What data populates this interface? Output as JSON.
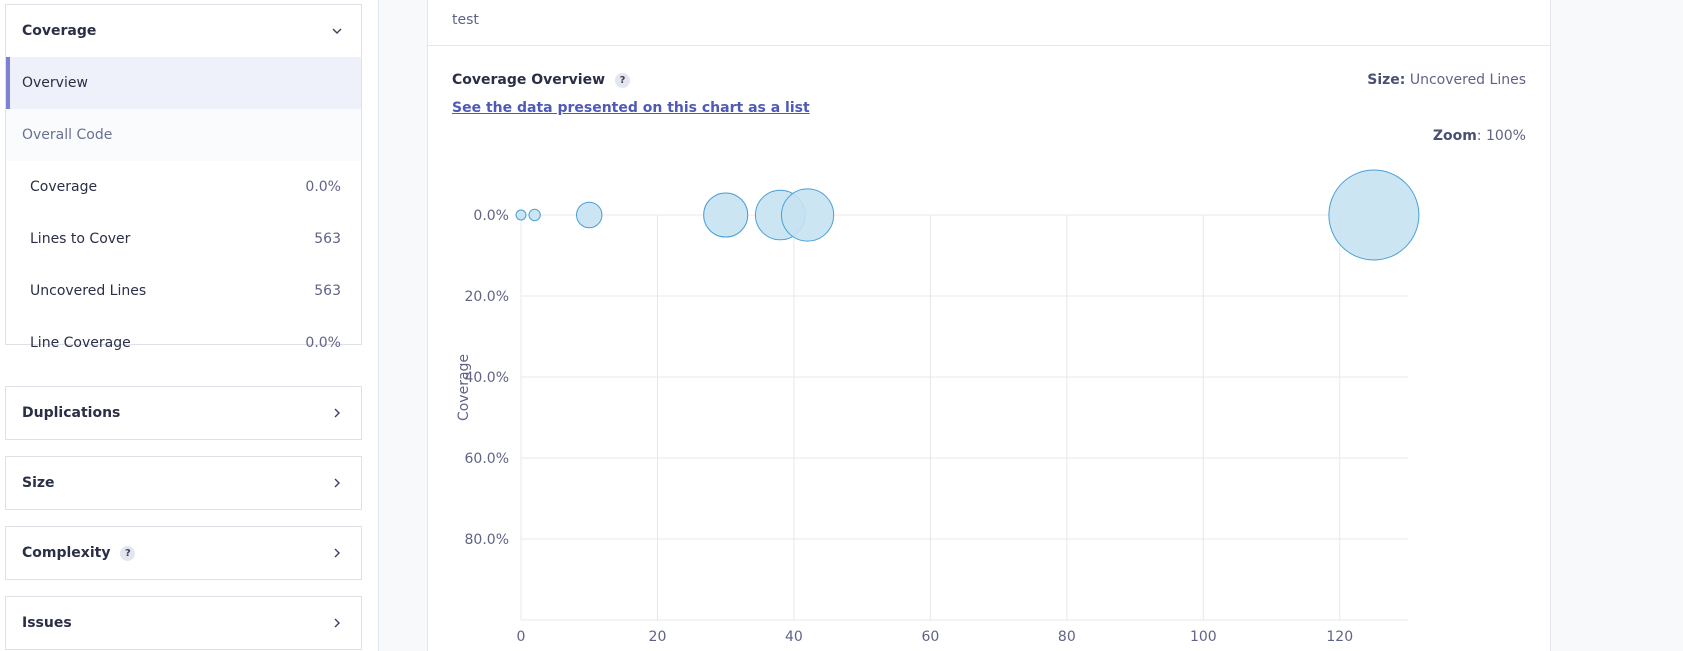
{
  "sidebar": {
    "coverage": {
      "title": "Coverage",
      "overview_label": "Overview",
      "group_label": "Overall Code",
      "metrics": [
        {
          "label": "Coverage",
          "value": "0.0%"
        },
        {
          "label": "Lines to Cover",
          "value": "563"
        },
        {
          "label": "Uncovered Lines",
          "value": "563"
        },
        {
          "label": "Line Coverage",
          "value": "0.0%"
        }
      ]
    },
    "sections": [
      {
        "label": "Duplications",
        "help": ""
      },
      {
        "label": "Size",
        "help": ""
      },
      {
        "label": "Complexity",
        "help": "?"
      },
      {
        "label": "Issues",
        "help": ""
      }
    ]
  },
  "main": {
    "breadcrumb": "test",
    "chart_title": "Coverage Overview",
    "help_icon": "?",
    "list_link": "See the data presented on this chart as a list",
    "size_key": "Size:",
    "size_value": "Uncovered Lines",
    "zoom_key": "Zoom",
    "zoom_value": ": 100%"
  },
  "chart_data": {
    "type": "scatter",
    "title": "",
    "xlabel": "",
    "ylabel": "Coverage",
    "xlim": [
      0,
      130
    ],
    "ylim": [
      0,
      100
    ],
    "x_ticks": [
      0,
      20,
      40,
      60,
      80,
      100,
      120
    ],
    "y_ticks": [
      0,
      20,
      40,
      60,
      80
    ],
    "y_tick_labels": [
      "0.0%",
      "20.0%",
      "40.0%",
      "60.0%",
      "80.0%"
    ],
    "size_metric": "Uncovered Lines",
    "points": [
      {
        "x": 0,
        "y": 0,
        "size": 1
      },
      {
        "x": 2,
        "y": 0,
        "size": 2
      },
      {
        "x": 10,
        "y": 0,
        "size": 10
      },
      {
        "x": 30,
        "y": 0,
        "size": 30
      },
      {
        "x": 38,
        "y": 0,
        "size": 38
      },
      {
        "x": 42,
        "y": 0,
        "size": 42
      },
      {
        "x": 125,
        "y": 0,
        "size": 125
      }
    ],
    "grid": true,
    "colors": {
      "bubble_fill": "#c7e2f1",
      "bubble_stroke": "#4b9fd5",
      "grid": "#e6e8ee",
      "axis_text": "#5f6485"
    }
  }
}
